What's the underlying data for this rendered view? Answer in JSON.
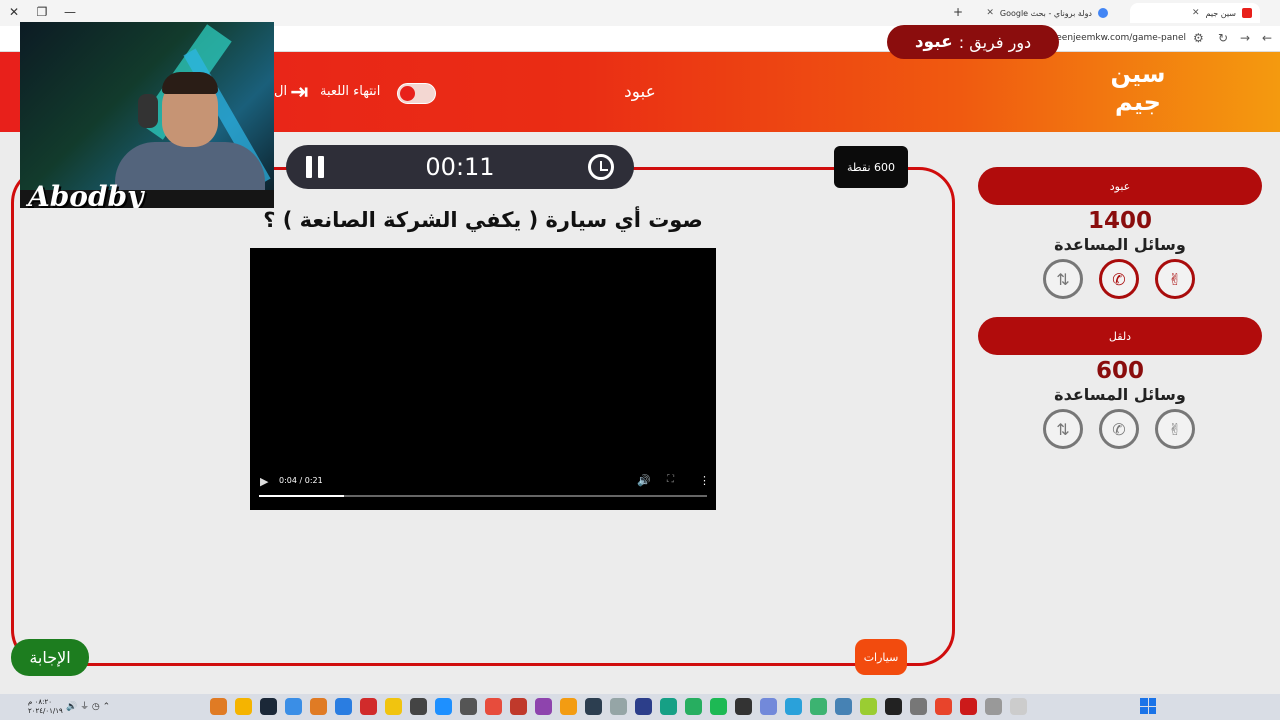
{
  "browser": {
    "tabs": [
      {
        "title": "سين جيم",
        "active": true
      },
      {
        "title": "دولة بروناي - بحث Google",
        "active": false
      }
    ],
    "url": "seenjeemkw.com/game-panel"
  },
  "header": {
    "logo_text": "سين جيم",
    "turn_label": "دور فريق :",
    "turn_team": "عبود",
    "center_name": "عبود",
    "end_game_label": "انتهاء اللعبة",
    "cut_letter": "ال"
  },
  "game": {
    "timer": "00:11",
    "points": "600 نقطة",
    "question": "صوت أي سيارة ( يكفي الشركة الصانعة ) ؟",
    "video": {
      "time": "0:04 / 0:21",
      "progress": 0.19
    },
    "category": "سيارات",
    "answer_button": "الإجابة"
  },
  "teams": [
    {
      "name": "عبود",
      "score": "1400",
      "help_label": "وسائل المساعدة",
      "helps_active": [
        true,
        true,
        false
      ]
    },
    {
      "name": "دلقل",
      "score": "600",
      "help_label": "وسائل المساعدة",
      "helps_active": [
        false,
        false,
        false
      ]
    }
  ],
  "webcam": {
    "brand": "Abodby"
  },
  "taskbar": {
    "time": "٠٨:٢٠ م",
    "date": "٢٠٢٤/٠١/١٩"
  },
  "colors": {
    "header_red": "#e8201b",
    "header_orange": "#f49a0f",
    "accent_dark_red": "#8b0d0d",
    "answer_green": "#1d7d1f"
  }
}
